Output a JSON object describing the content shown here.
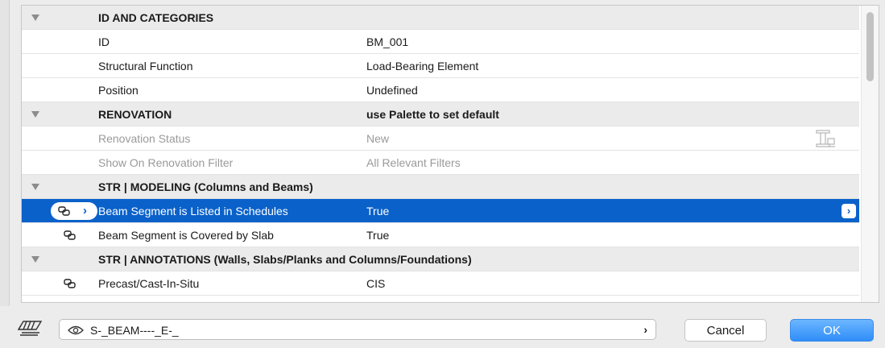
{
  "panel": {
    "rows": [
      {
        "kind": "group",
        "name": "ID AND CATEGORIES",
        "value": ""
      },
      {
        "kind": "prop",
        "name": "ID",
        "value": "BM_001"
      },
      {
        "kind": "prop",
        "name": "Structural Function",
        "value": "Load-Bearing Element"
      },
      {
        "kind": "prop",
        "name": "Position",
        "value": "Undefined"
      },
      {
        "kind": "group",
        "name": "RENOVATION",
        "value": "use Palette to set default"
      },
      {
        "kind": "disabled",
        "name": "Renovation Status",
        "value": "New"
      },
      {
        "kind": "disabled",
        "name": "Show On Renovation Filter",
        "value": "All Relevant Filters"
      },
      {
        "kind": "group",
        "name": "STR | MODELING (Columns and Beams)",
        "value": ""
      },
      {
        "kind": "selected",
        "name": "Beam Segment is Listed in Schedules",
        "value": "True"
      },
      {
        "kind": "linked",
        "name": "Beam Segment is Covered by Slab",
        "value": "True"
      },
      {
        "kind": "group",
        "name": "STR | ANNOTATIONS (Walls, Slabs/Planks and Columns/Foundations)",
        "value": ""
      },
      {
        "kind": "linked",
        "name": "Precast/Cast-In-Situ",
        "value": "CIS"
      }
    ]
  },
  "footer": {
    "criteria_text": "S-_BEAM----_E-_",
    "cancel_label": "Cancel",
    "ok_label": "OK"
  },
  "colors": {
    "selection": "#0a61c9",
    "ok_button": "#2f8ef8"
  },
  "icons": {
    "group_toggle": "disclosure-triangle-icon",
    "linked": "link-icon",
    "renovation": "renovation-filter-icon",
    "layer": "layer-icon",
    "visibility": "eye-icon"
  }
}
